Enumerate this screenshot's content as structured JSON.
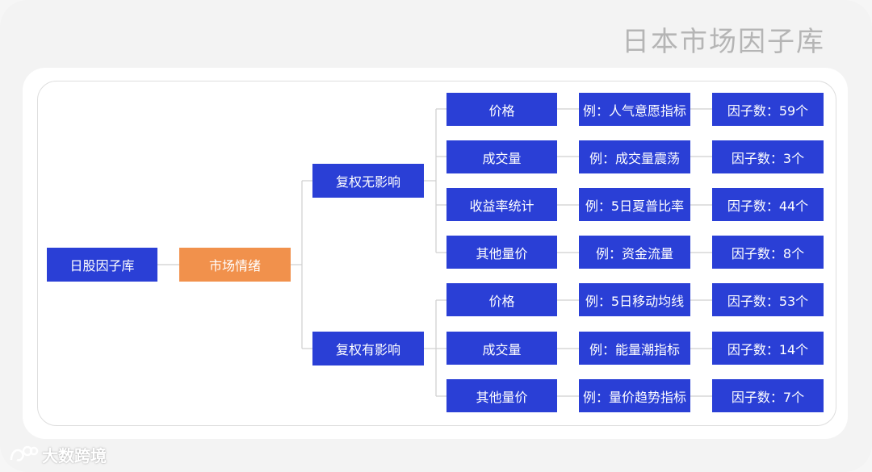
{
  "title": "日本市场因子库",
  "root": "日股因子库",
  "market": "市场情绪",
  "groups": [
    {
      "label": "复权无影响",
      "rows": [
        {
          "category": "价格",
          "example": "例：人气意愿指标",
          "count": "因子数：59个"
        },
        {
          "category": "成交量",
          "example": "例：成交量震荡",
          "count": "因子数：3个"
        },
        {
          "category": "收益率统计",
          "example": "例：5日夏普比率",
          "count": "因子数：44个"
        },
        {
          "category": "其他量价",
          "example": "例：资金流量",
          "count": "因子数：8个"
        }
      ]
    },
    {
      "label": "复权有影响",
      "rows": [
        {
          "category": "价格",
          "example": "例：5日移动均线",
          "count": "因子数：53个"
        },
        {
          "category": "成交量",
          "example": "例：能量潮指标",
          "count": "因子数：14个"
        },
        {
          "category": "其他量价",
          "example": "例：量价趋势指标",
          "count": "因子数：7个"
        }
      ]
    }
  ],
  "watermark": "大数跨境",
  "colors": {
    "box_blue": "#2a3fd6",
    "box_orange": "#f1914c",
    "line": "#cfcfcf",
    "title": "#b5b5b5"
  }
}
